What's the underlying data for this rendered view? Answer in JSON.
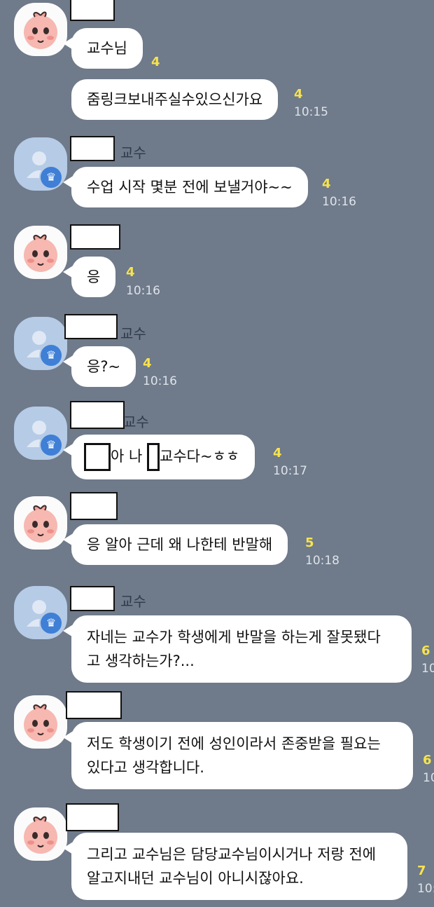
{
  "messages": [
    {
      "sender": "student",
      "text": "교수님",
      "unread": "4",
      "time": ""
    },
    {
      "sender": "student",
      "text": "줌링크보내주실수있으신가요",
      "unread": "4",
      "time": "10:15"
    },
    {
      "sender": "professor",
      "role_label": "교수",
      "text": "수업 시작 몇분 전에 보낼거야~~",
      "unread": "4",
      "time": "10:16"
    },
    {
      "sender": "student",
      "text": "응",
      "unread": "4",
      "time": "10:16"
    },
    {
      "sender": "professor",
      "role_label": "교수",
      "text": "응?~",
      "unread": "4",
      "time": "10:16"
    },
    {
      "sender": "professor",
      "role_label": "교수",
      "text_parts": [
        "아 나",
        "교수다~ㅎㅎ"
      ],
      "unread": "4",
      "time": "10:17"
    },
    {
      "sender": "student",
      "text": "응 알아 근데 왜 나한테 반말해",
      "unread": "5",
      "time": "10:18"
    },
    {
      "sender": "professor",
      "role_label": "교수",
      "text_lines": [
        "자네는 교수가 학생에게 반말을 하는게 잘못됐다",
        "고 생각하는가?..."
      ],
      "unread": "6",
      "time": "10"
    },
    {
      "sender": "student",
      "text_lines": [
        "저도 학생이기 전에 성인이라서 존중받을 필요는",
        "있다고 생각합니다."
      ],
      "unread": "6",
      "time": "10"
    },
    {
      "sender": "student",
      "text_lines": [
        "그리고 교수님은 담당교수님이시거나 저랑 전에",
        "알고지내던 교수님이 아니시잖아요."
      ],
      "unread": "7",
      "time": "10:"
    }
  ],
  "icons": {
    "crown": "crown-icon",
    "peach_avatar": "peach-character-avatar",
    "default_avatar": "default-profile-avatar"
  }
}
